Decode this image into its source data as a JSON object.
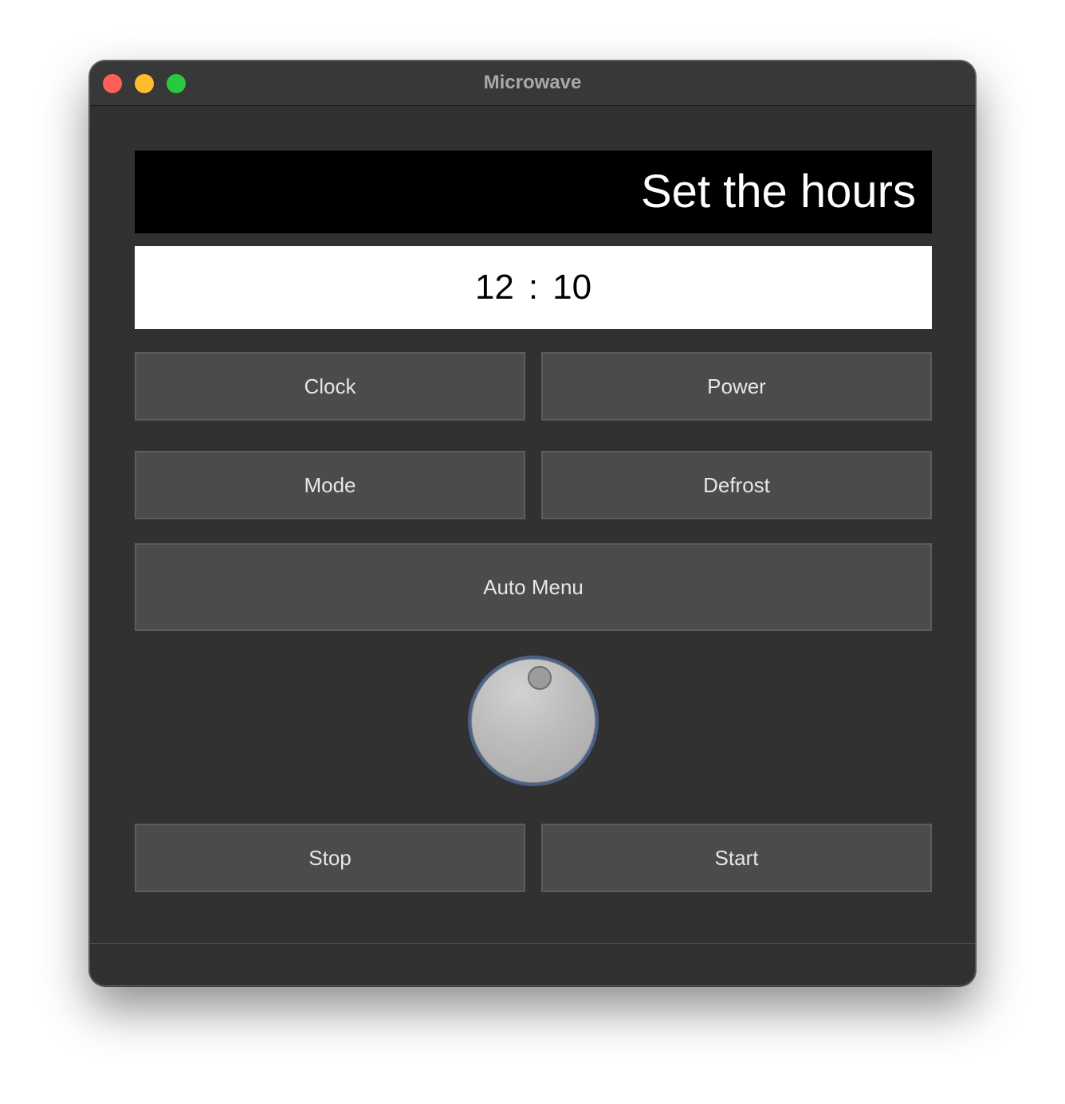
{
  "window": {
    "title": "Microwave"
  },
  "display": {
    "status_text": "Set the hours",
    "hours": "12",
    "separator": ":",
    "minutes": "10"
  },
  "buttons": {
    "clock": "Clock",
    "power": "Power",
    "mode": "Mode",
    "defrost": "Defrost",
    "auto_menu": "Auto Menu",
    "stop": "Stop",
    "start": "Start"
  },
  "colors": {
    "close": "#fe5f57",
    "minimize": "#febc2e",
    "maximize": "#28c840",
    "knob_ring": "#4b6288"
  }
}
